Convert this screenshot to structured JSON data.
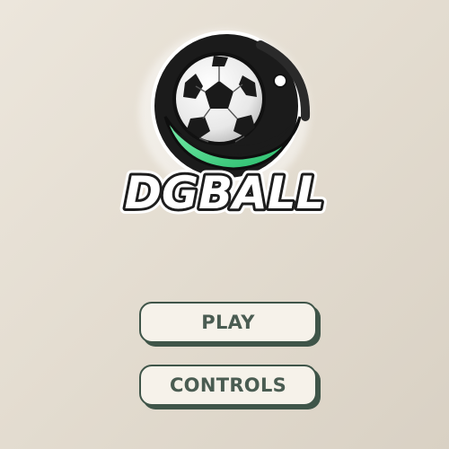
{
  "logo": {
    "text": "DGBALL",
    "icon": "soccer-ball-icon"
  },
  "menu": {
    "play_label": "PLAY",
    "controls_label": "CONTROLS"
  },
  "colors": {
    "background": "#e4ddd1",
    "accent_green": "#3ddc84",
    "button_fill": "#f6f2ea",
    "button_border": "#3f5549",
    "button_text": "#4a5c52"
  }
}
